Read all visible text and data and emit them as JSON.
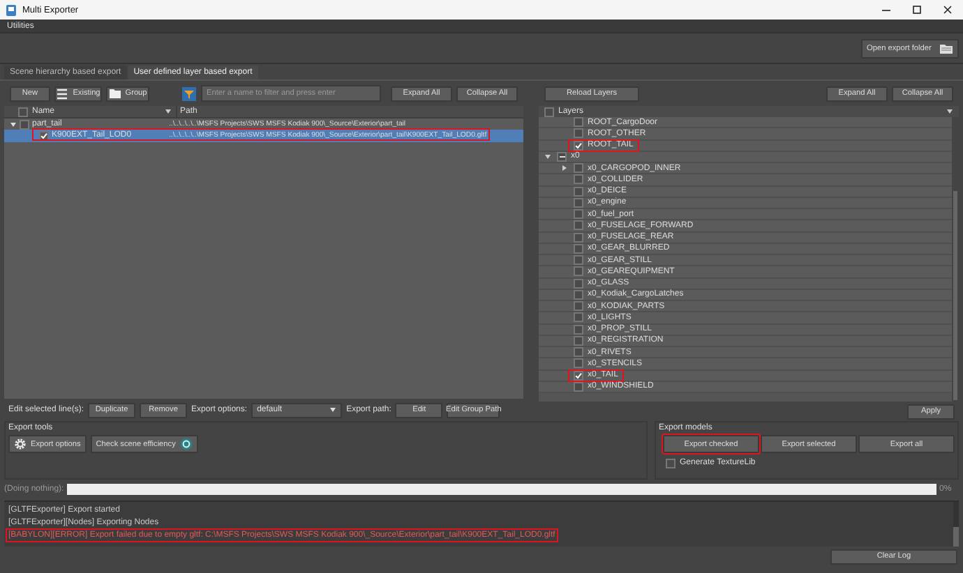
{
  "window": {
    "title": "Multi Exporter"
  },
  "menu": [
    "Utilities"
  ],
  "toolbar": {
    "open_folder": "Open export folder"
  },
  "tabs": [
    {
      "label": "Scene hierarchy based export",
      "selected": false
    },
    {
      "label": "User defined layer based export",
      "selected": true
    }
  ],
  "export_list": {
    "buttons": [
      {
        "label": "New",
        "kind": "plain"
      },
      {
        "label": "Existing",
        "kind": "list"
      },
      {
        "label": "Group",
        "kind": "folder"
      }
    ],
    "filter": {
      "placeholder": "Enter a name to filter and press enter"
    },
    "expand": "Expand All",
    "collapse": "Collapse All",
    "header_checked": false,
    "columns": [
      "Name",
      "Path"
    ],
    "rows": [
      {
        "name": "part_tail",
        "path": "..\\..\\..\\..\\..\\MSFS Projects\\SWS MSFS Kodiak 900\\_Source\\Exterior\\part_tail",
        "checked": false,
        "expanded": true,
        "selected": false,
        "highlighted": false,
        "children": [
          {
            "name": "K900EXT_Tail_LOD0",
            "path": "..\\..\\..\\..\\..\\MSFS Projects\\SWS MSFS Kodiak 900\\_Source\\Exterior\\part_tail\\K900EXT_Tail_LOD0.gltf",
            "checked": true,
            "selected": true,
            "highlighted": true
          }
        ]
      }
    ]
  },
  "edit_bar": {
    "label": "Edit selected line(s):",
    "duplicate": "Duplicate",
    "remove": "Remove",
    "options_label": "Export options:",
    "options_value": "default",
    "path_label": "Export path:",
    "edit": "Edit",
    "edit_group": "Edit Group Path"
  },
  "layers_panel": {
    "reload": "Reload Layers",
    "expand": "Expand All",
    "collapse": "Collapse All",
    "header": "Layers",
    "header_checked": false,
    "items": [
      {
        "label": "ROOT_CargoDoor",
        "kind": "layer",
        "checked": false,
        "highlighted": false
      },
      {
        "label": "ROOT_OTHER",
        "kind": "layer",
        "checked": false,
        "highlighted": false
      },
      {
        "label": "ROOT_TAIL",
        "kind": "layer",
        "checked": true,
        "highlighted": true
      },
      {
        "label": "x0",
        "kind": "group",
        "partial": true,
        "expanded": true,
        "highlighted": false,
        "children": [
          {
            "label": "x0_CARGOPOD_INNER",
            "kind": "group",
            "checked": false,
            "partial": false,
            "expanded": false,
            "highlighted": false
          },
          {
            "label": "x0_COLLIDER",
            "kind": "layer",
            "checked": false,
            "highlighted": false
          },
          {
            "label": "x0_DEICE",
            "kind": "layer",
            "checked": false,
            "highlighted": false
          },
          {
            "label": "x0_engine",
            "kind": "layer",
            "checked": false,
            "highlighted": false
          },
          {
            "label": "x0_fuel_port",
            "kind": "layer",
            "checked": false,
            "highlighted": false
          },
          {
            "label": "x0_FUSELAGE_FORWARD",
            "kind": "layer",
            "checked": false,
            "highlighted": false
          },
          {
            "label": "x0_FUSELAGE_REAR",
            "kind": "layer",
            "checked": false,
            "highlighted": false
          },
          {
            "label": "x0_GEAR_BLURRED",
            "kind": "layer",
            "checked": false,
            "highlighted": false
          },
          {
            "label": "x0_GEAR_STILL",
            "kind": "layer",
            "checked": false,
            "highlighted": false
          },
          {
            "label": "x0_GEAREQUIPMENT",
            "kind": "layer",
            "checked": false,
            "highlighted": false
          },
          {
            "label": "x0_GLASS",
            "kind": "layer",
            "checked": false,
            "highlighted": false
          },
          {
            "label": "x0_Kodiak_CargoLatches",
            "kind": "layer",
            "checked": false,
            "highlighted": false
          },
          {
            "label": "x0_KODIAK_PARTS",
            "kind": "layer",
            "checked": false,
            "highlighted": false
          },
          {
            "label": "x0_LIGHTS",
            "kind": "layer",
            "checked": false,
            "highlighted": false
          },
          {
            "label": "x0_PROP_STILL",
            "kind": "layer",
            "checked": false,
            "highlighted": false
          },
          {
            "label": "x0_REGISTRATION",
            "kind": "layer",
            "checked": false,
            "highlighted": false
          },
          {
            "label": "x0_RIVETS",
            "kind": "layer",
            "checked": false,
            "highlighted": false
          },
          {
            "label": "x0_STENCILS",
            "kind": "layer",
            "checked": false,
            "highlighted": false
          },
          {
            "label": "x0_TAIL",
            "kind": "layer",
            "checked": true,
            "highlighted": true
          },
          {
            "label": "x0_WINDSHIELD",
            "kind": "layer",
            "checked": false,
            "highlighted": false
          }
        ]
      }
    ],
    "apply": "Apply"
  },
  "export_tools": {
    "title": "Export tools",
    "buttons": [
      {
        "label": "Export options",
        "kind": "options"
      },
      {
        "label": "Check scene efficiency",
        "kind": "efficiency"
      }
    ]
  },
  "export_models": {
    "title": "Export models",
    "buttons": [
      {
        "label": "Export checked",
        "highlighted": true
      },
      {
        "label": "Export selected",
        "highlighted": false
      },
      {
        "label": "Export all",
        "highlighted": false
      }
    ],
    "texture_lib": {
      "label": "Generate TextureLib",
      "checked": false
    }
  },
  "progress": {
    "label": "(Doing nothing):",
    "level": 0,
    "reading": "0%"
  },
  "log": {
    "lines": [
      {
        "text": "[GLTFExporter] Export started",
        "kind": "info",
        "highlighted": false
      },
      {
        "text": "[GLTFExporter][Nodes] Exporting Nodes",
        "kind": "info",
        "highlighted": false
      },
      {
        "text": "[BABYLON][ERROR] Export failed due to empty gltf: C:\\MSFS Projects\\SWS MSFS Kodiak 900\\_Source\\Exterior\\part_tail\\K900EXT_Tail_LOD0.gltf",
        "kind": "error",
        "highlighted": true
      }
    ],
    "clear": "Clear Log"
  }
}
